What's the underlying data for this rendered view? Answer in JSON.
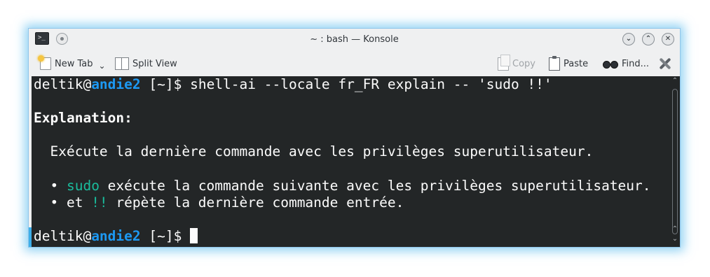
{
  "window": {
    "title": "~ : bash — Konsole",
    "app_icon": "terminal-icon",
    "buttons": [
      "minimize",
      "maximize",
      "close"
    ]
  },
  "toolbar": {
    "new_tab": "New Tab",
    "split_view": "Split View",
    "copy": "Copy",
    "paste": "Paste",
    "find": "Find..."
  },
  "terminal": {
    "prompt_user": "deltik@",
    "prompt_host": "andie2",
    "prompt_path": " [~]$ ",
    "command": "shell-ai --locale fr_FR explain -- 'sudo !!'",
    "heading": "Explanation:",
    "summary": "  Exécute la dernière commande avec les privilèges superutilisateur.",
    "bullet1_prefix": "  • ",
    "bullet1_keyword": "sudo",
    "bullet1_text": " exécute la commande suivante avec les privilèges superutilisateur.",
    "bullet2_prefix": "  • et ",
    "bullet2_keyword": "!!",
    "bullet2_text": " répète la dernière commande entrée."
  },
  "colors": {
    "terminal_bg": "#232627",
    "text": "#fcfcfc",
    "host": "#1d99f3",
    "keyword": "#1abc9c",
    "accent_glow": "#3daee9"
  }
}
